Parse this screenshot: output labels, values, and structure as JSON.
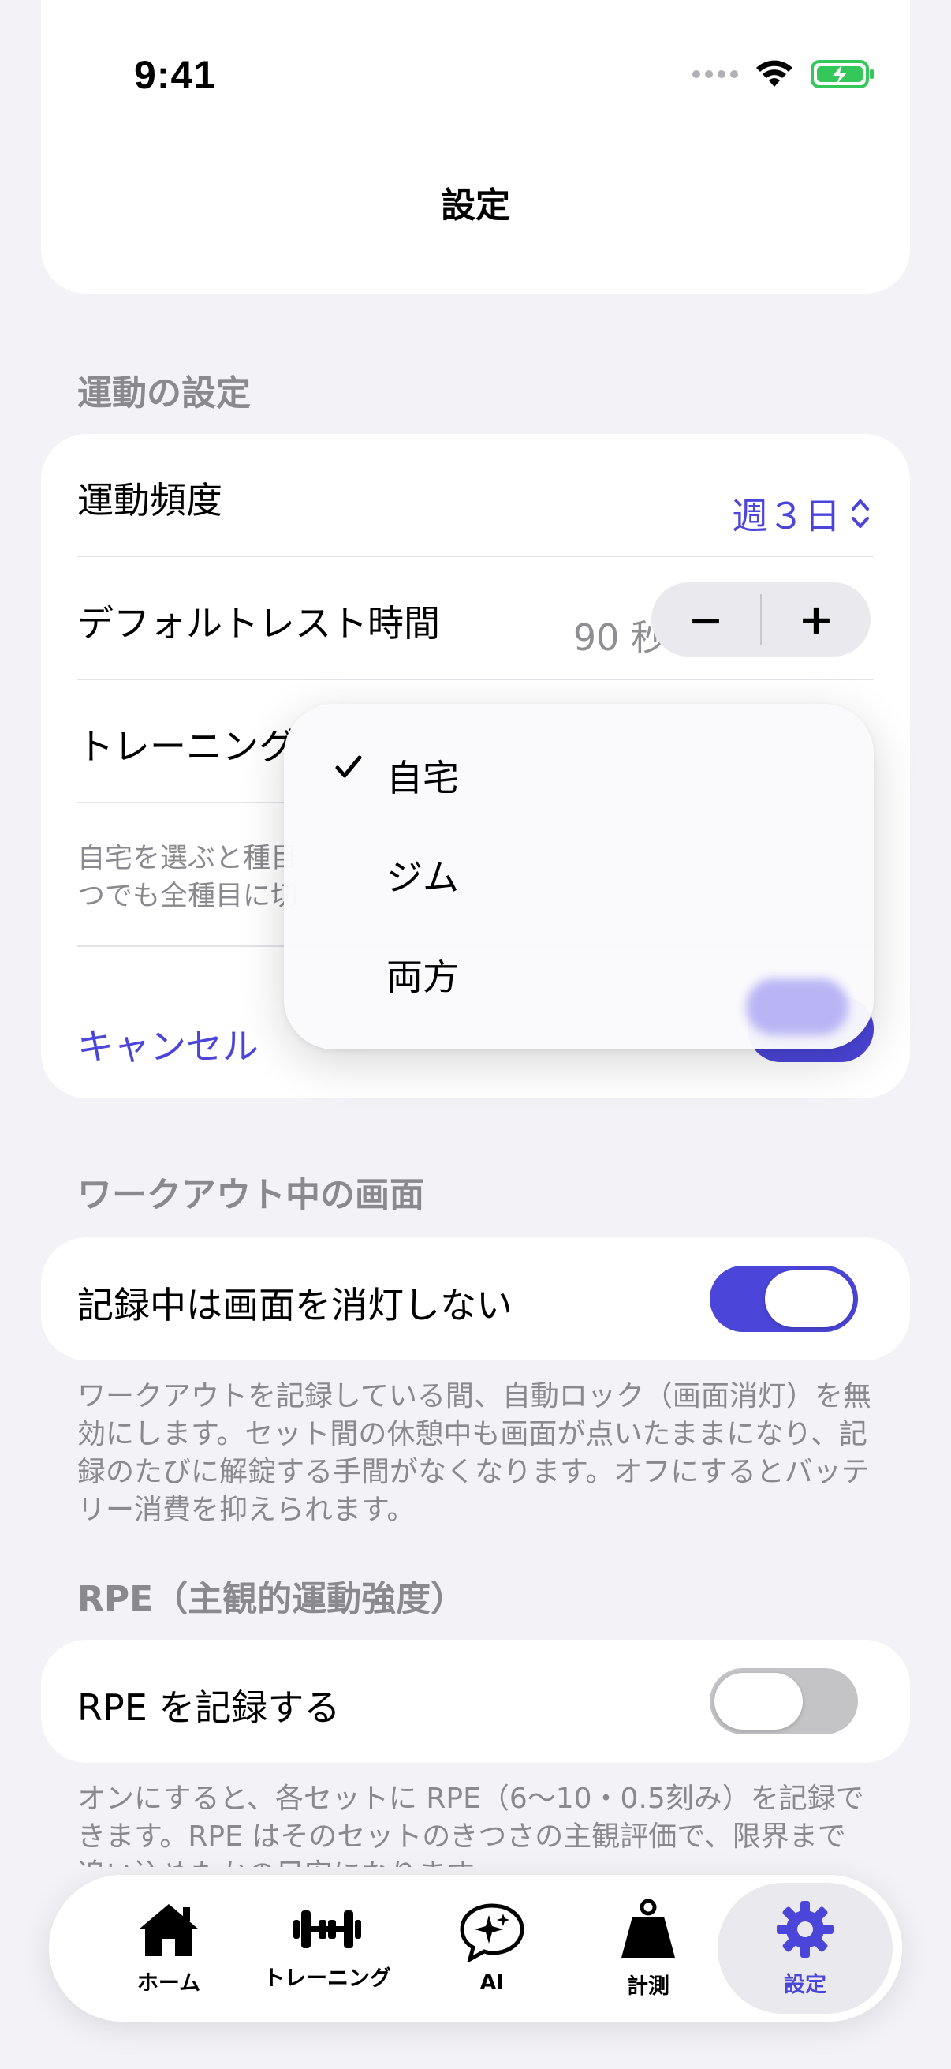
{
  "status_bar": {
    "time": "9:41"
  },
  "nav": {
    "title": "設定"
  },
  "exercise_section": {
    "header": "運動の設定",
    "frequency": {
      "label": "運動頻度",
      "value": "週３日"
    },
    "rest": {
      "label": "デフォルトレスト時間",
      "value": "90 秒",
      "minus": "−",
      "plus": "+"
    },
    "training_place": {
      "label": "トレーニング"
    },
    "note_line1": "自宅を選ぶと種目",
    "note_line2": "つでも全種目に切",
    "cancel": "キャンセル"
  },
  "place_menu": {
    "options": [
      "自宅",
      "ジム",
      "両方"
    ],
    "selected": "自宅"
  },
  "workout_screen_section": {
    "header": "ワークアウト中の画面",
    "keep_awake": {
      "label": "記録中は画面を消灯しない",
      "on": true
    },
    "footnote": "ワークアウトを記録している間、自動ロック（画面消灯）を無効にします。セット間の休憩中も画面が点いたままになり、記録のたびに解錠する手間がなくなります。オフにするとバッテリー消費を抑えられます。"
  },
  "rpe_section": {
    "header": "RPE（主観的運動強度）",
    "record_rpe": {
      "label": "RPE を記録する",
      "on": false
    },
    "footnote": "オンにすると、各セットに RPE（6〜10・0.5刻み）を記録できます。RPE はそのセットのきつさの主観評価で、限界まで追い込めたかの目安になります。"
  },
  "tab_bar": {
    "tabs": [
      {
        "label": "ホーム",
        "icon": "house-icon"
      },
      {
        "label": "トレーニング",
        "icon": "dumbbell-icon"
      },
      {
        "label": "AI",
        "icon": "sparkle-bubble-icon"
      },
      {
        "label": "計測",
        "icon": "weight-icon"
      },
      {
        "label": "設定",
        "icon": "gear-icon"
      }
    ],
    "active": "設定"
  },
  "colors": {
    "accent": "#4b45d9",
    "background": "#f2f2f7",
    "toggle_off": "#c4c4c7"
  }
}
